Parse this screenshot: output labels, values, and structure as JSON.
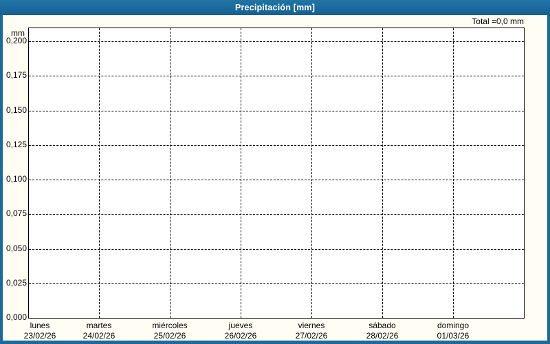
{
  "window": {
    "title": "Precipitación [mm]",
    "accent_color": "#1b6a9c"
  },
  "chart_data": {
    "type": "bar",
    "title": "Precipitación [mm]",
    "total_label": "Total =0,0 mm",
    "total_value_mm": 0.0,
    "unit_label": "mm",
    "categories": [
      {
        "day": "lunes",
        "date": "23/02/26"
      },
      {
        "day": "martes",
        "date": "24/02/26"
      },
      {
        "day": "miércoles",
        "date": "25/02/26"
      },
      {
        "day": "jueves",
        "date": "26/02/26"
      },
      {
        "day": "viernes",
        "date": "27/02/26"
      },
      {
        "day": "sábado",
        "date": "28/02/26"
      },
      {
        "day": "domingo",
        "date": "01/03/26"
      }
    ],
    "series": [
      {
        "name": "Precipitación",
        "values": [
          0,
          0,
          0,
          0,
          0,
          0,
          0
        ]
      }
    ],
    "y_ticks": [
      "0,200",
      "0,175",
      "0,150",
      "0,125",
      "0,100",
      "0,075",
      "0,050",
      "0,025",
      "0,000"
    ],
    "y_tick_values": [
      0.2,
      0.175,
      0.15,
      0.125,
      0.1,
      0.075,
      0.05,
      0.025,
      0.0
    ],
    "ylim": [
      0,
      0.21
    ],
    "xlabel": "",
    "ylabel": "mm",
    "grid": "dashed-both-axes",
    "legend": "none",
    "colors": {
      "titlebar": "#1b6a9c",
      "frame": "#1b6a9c",
      "grid": "#000000",
      "plot_bg": "#ffffff",
      "canvas_bg": "#fffdf4",
      "text": "#000000"
    }
  }
}
